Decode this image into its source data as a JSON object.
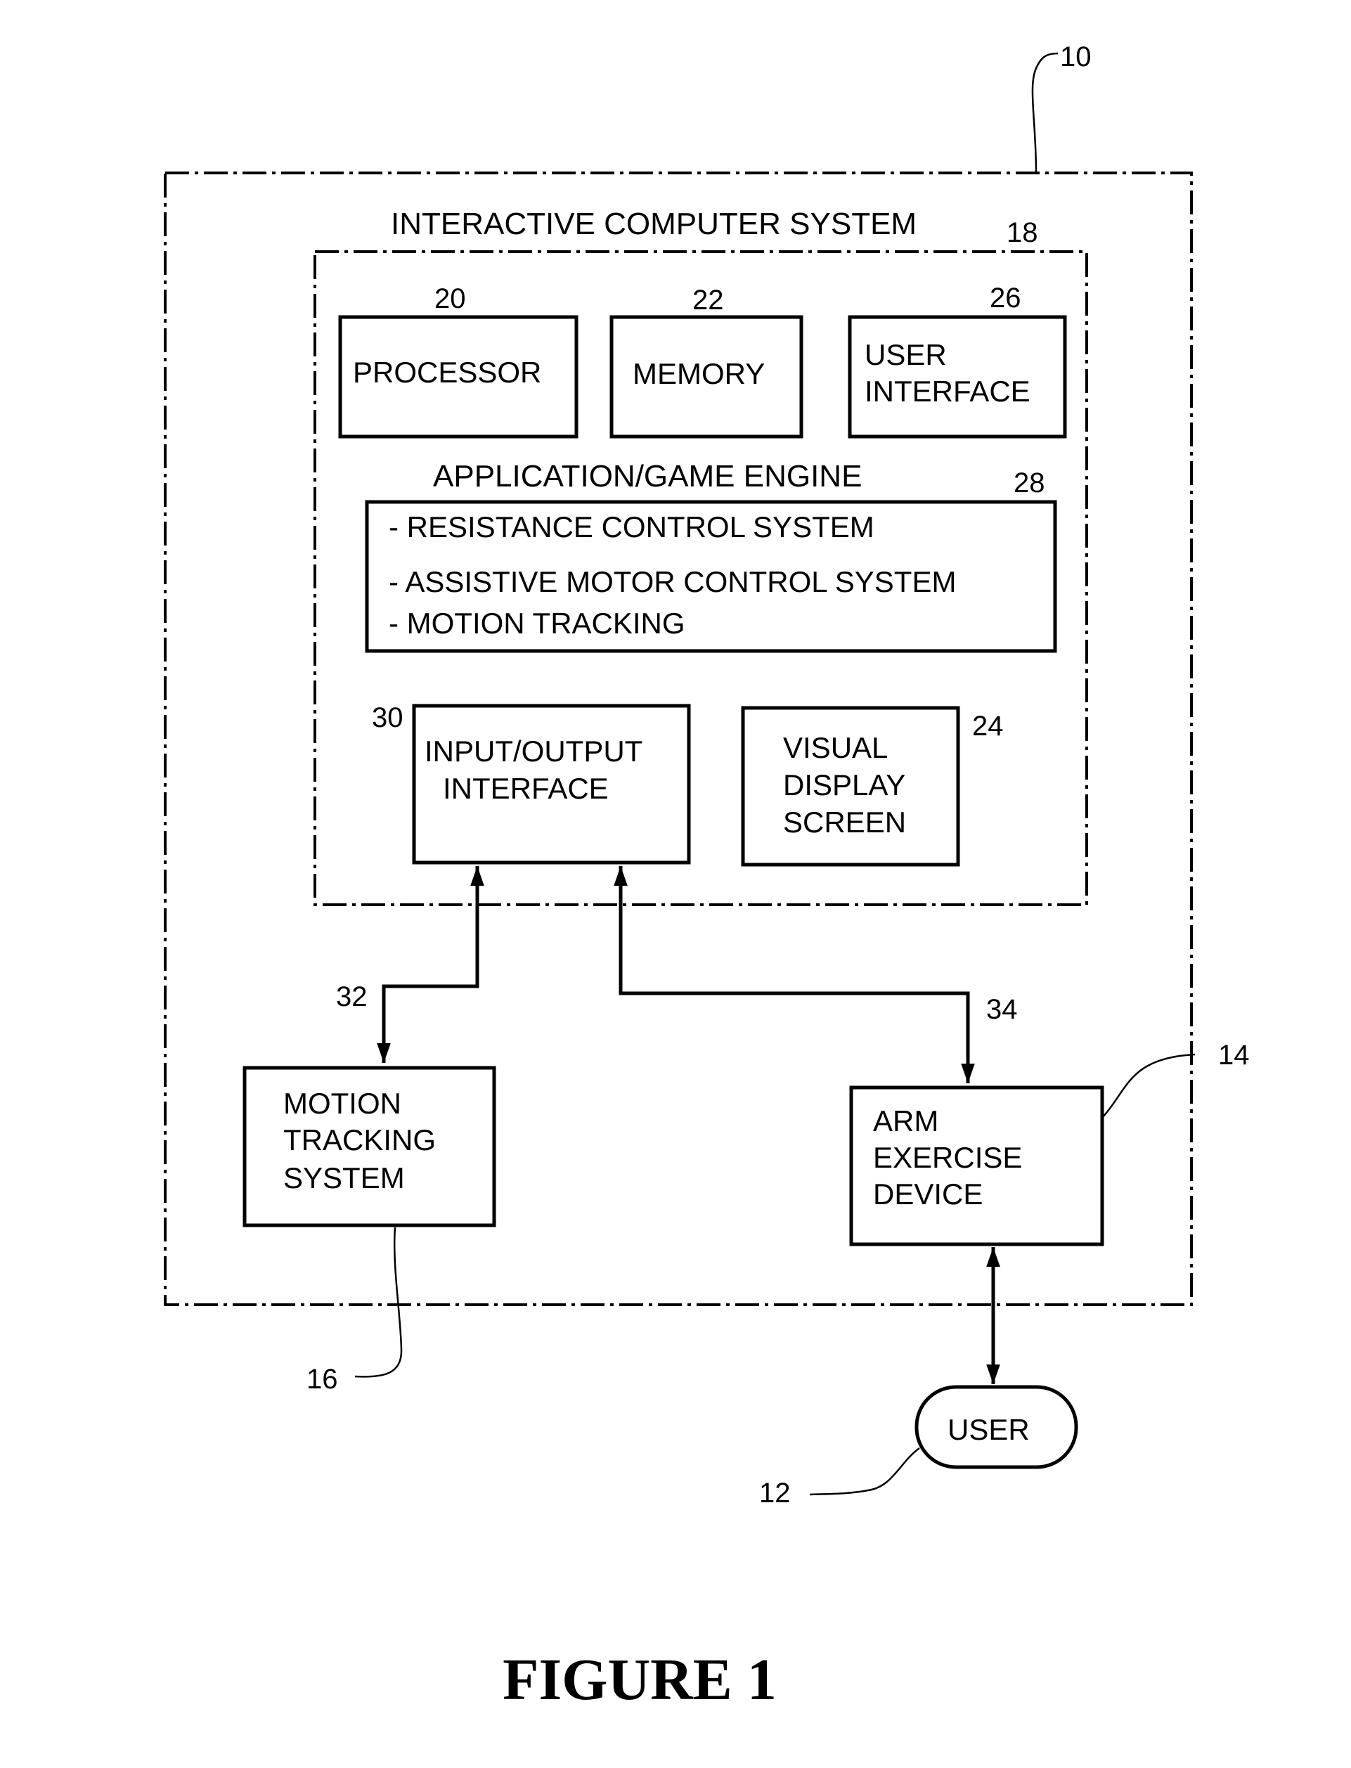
{
  "figure_title": "FIGURE 1",
  "system": {
    "ref": "10",
    "title": "INTERACTIVE COMPUTER SYSTEM",
    "computer_ref": "18"
  },
  "blocks": {
    "processor": {
      "ref": "20",
      "lines": [
        "PROCESSOR"
      ]
    },
    "memory": {
      "ref": "22",
      "lines": [
        "MEMORY"
      ]
    },
    "user_interface": {
      "ref": "26",
      "lines": [
        "USER",
        "INTERFACE"
      ]
    },
    "engine": {
      "ref": "28",
      "title": "APPLICATION/GAME ENGINE",
      "items": [
        "- RESISTANCE CONTROL SYSTEM",
        "- ASSISTIVE MOTOR CONTROL SYSTEM",
        "- MOTION TRACKING"
      ]
    },
    "io_interface": {
      "ref": "30",
      "lines": [
        "INPUT/OUTPUT",
        "INTERFACE"
      ]
    },
    "visual_display": {
      "ref": "24",
      "lines": [
        "VISUAL",
        "DISPLAY",
        "SCREEN"
      ]
    },
    "motion_tracking": {
      "ref": "16",
      "lines": [
        "MOTION",
        "TRACKING",
        "SYSTEM"
      ]
    },
    "arm_device": {
      "ref": "14",
      "lines": [
        "ARM",
        "EXERCISE",
        "DEVICE"
      ]
    },
    "user": {
      "ref": "12",
      "label": "USER"
    }
  },
  "connections": {
    "io_to_motion": {
      "ref": "32"
    },
    "io_to_arm": {
      "ref": "34"
    }
  }
}
